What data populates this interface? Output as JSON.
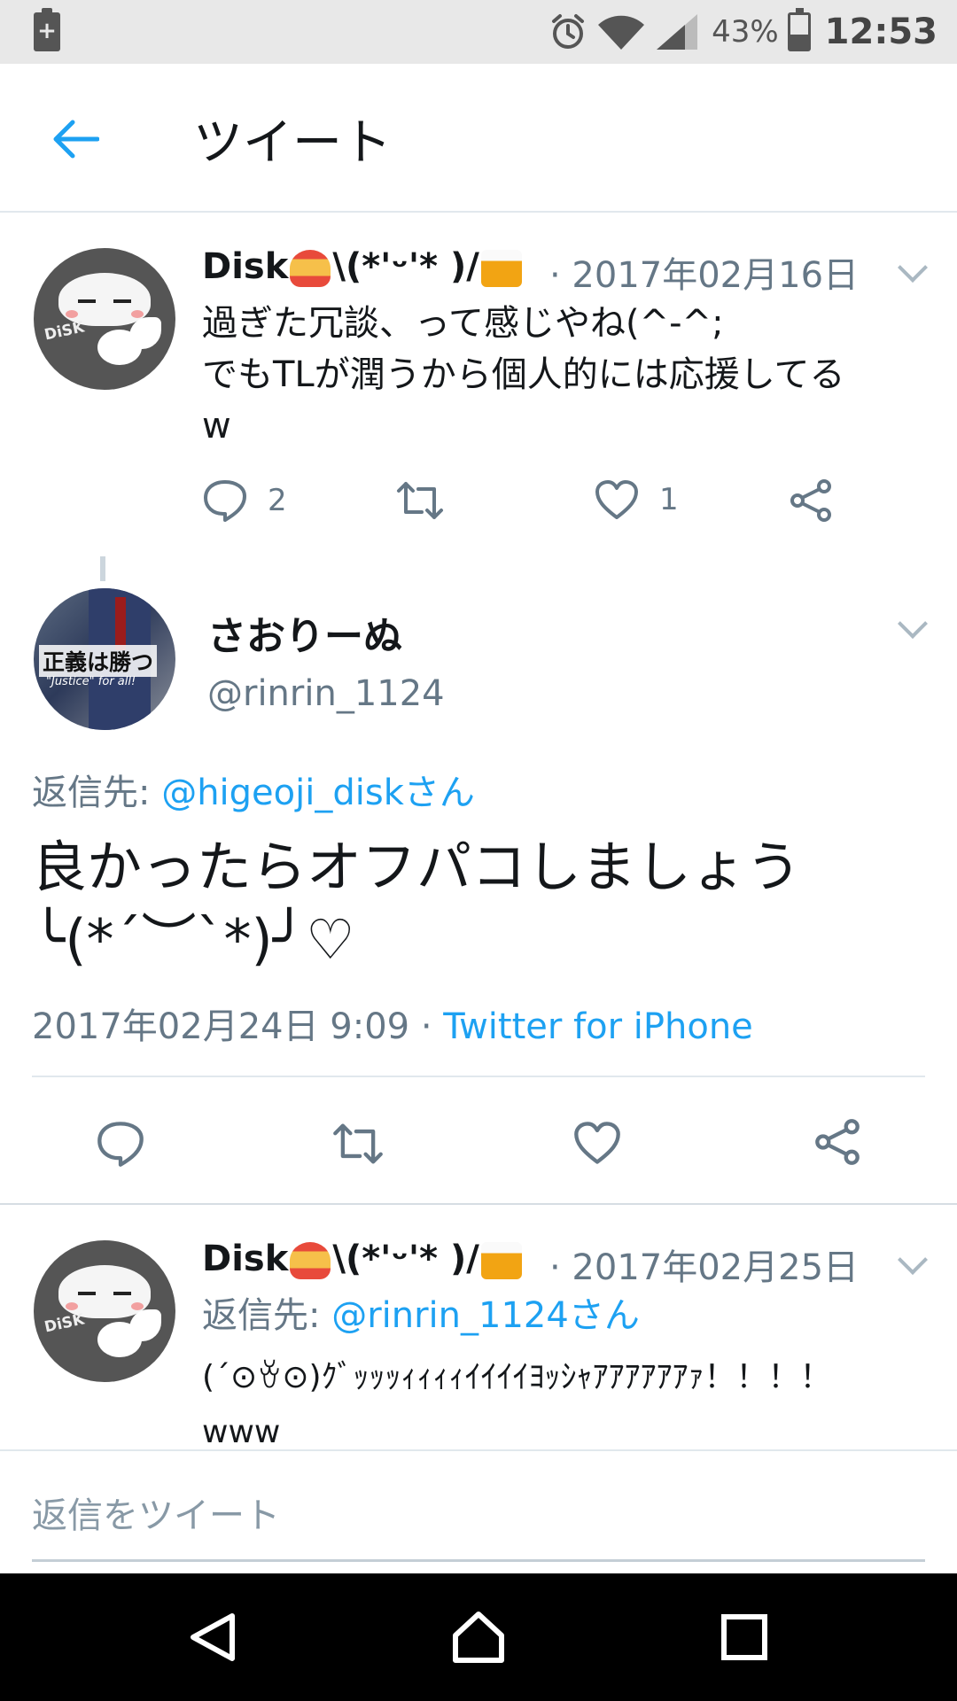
{
  "status_bar": {
    "battery_percent": "43%",
    "time": "12:53",
    "icons": [
      "battery-saver-icon",
      "alarm-icon",
      "wifi-icon",
      "signal-icon",
      "battery-icon"
    ],
    "battery_level": 0.43
  },
  "app_bar": {
    "title": "ツイート",
    "back_icon": "back-arrow-icon"
  },
  "tweets_above": [
    {
      "name": "Disk",
      "name_suffix_1": "\\(*'ᵕ'* )/",
      "date": "· 2017年02月16日",
      "text": "過ぎた冗談、って感じやね(^-^;\nでもTLが潤うから個人的には応援してる\nw",
      "replies": "2",
      "retweets": "",
      "likes": "1"
    }
  ],
  "focus_tweet": {
    "name": "さおりーぬ",
    "handle": "@rinrin_1124",
    "reply_label": "返信先: ",
    "reply_target": "@higeoji_diskさん",
    "text": "良かったらオフパコしましょう\n╰(*´︶`*)╯♡",
    "datetime": "2017年02月24日 9:09 · ",
    "source": "Twitter for iPhone"
  },
  "tweets_below": [
    {
      "name": "Disk",
      "name_suffix_1": "\\(*'ᵕ'* )/",
      "date": "· 2017年02月25日",
      "reply_label": "返信先: ",
      "reply_target": "@rinrin_1124さん",
      "text": "(´⊙ꈊ⊙)ｸﾞｯｯｯｨｨｨｨｲｲｲｲﾖｯｼｬｱｱｱｱｱｱｧ！！！！\nwww"
    }
  ],
  "reply_box": {
    "placeholder": "返信をツイート"
  },
  "nav_bar": {
    "icons": [
      "back-triangle-icon",
      "home-icon",
      "recents-square-icon"
    ]
  },
  "colors": {
    "accent": "#1da1f2",
    "text": "#14171a",
    "muted": "#657786",
    "divider": "#e1e8ed"
  }
}
